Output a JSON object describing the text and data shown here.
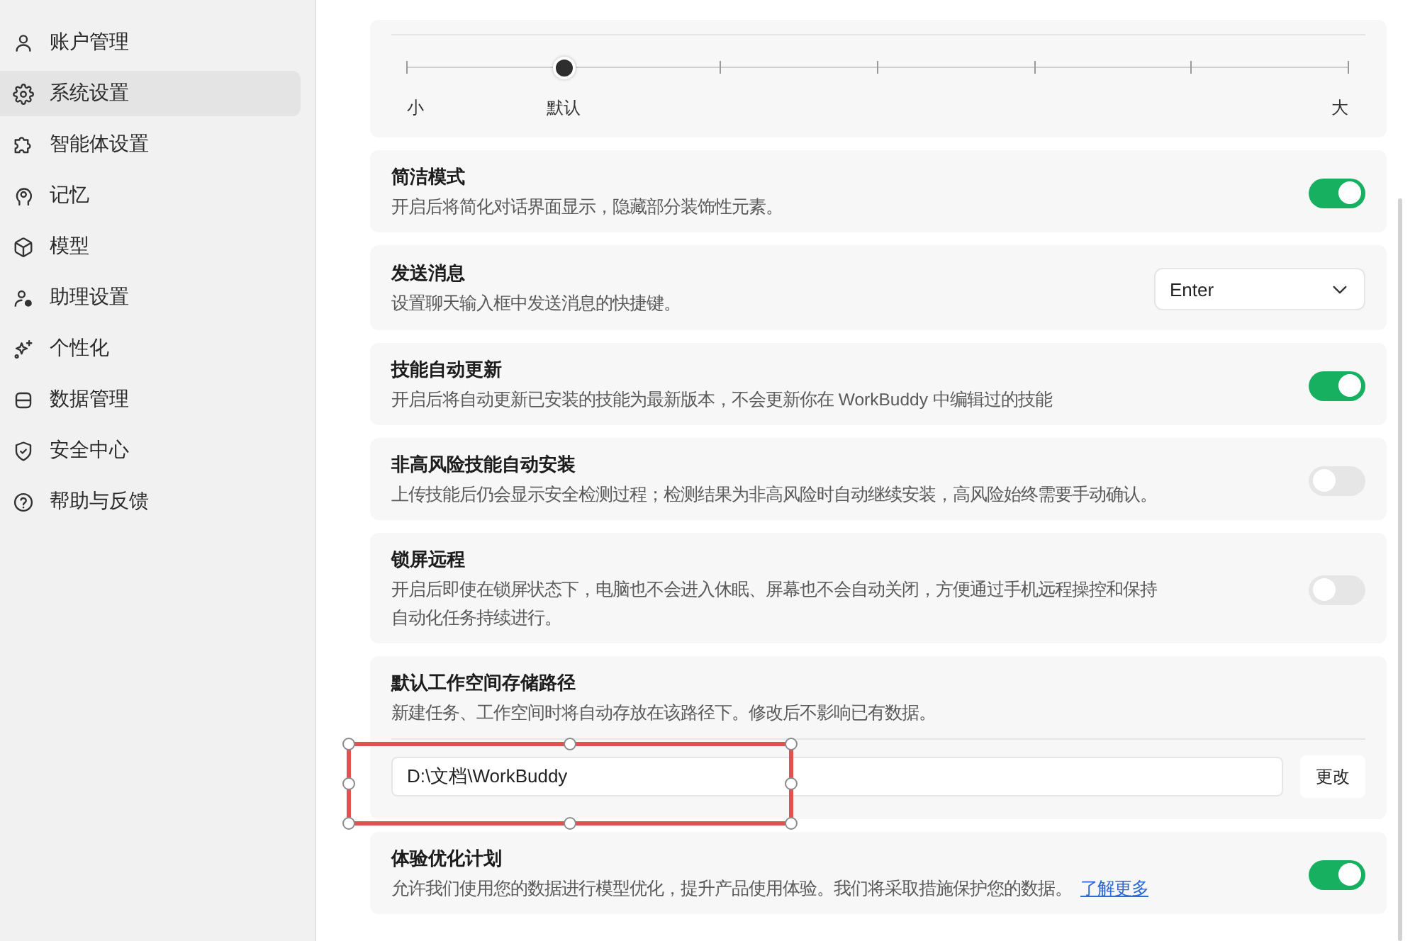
{
  "sidebar": {
    "items": [
      {
        "label": "账户管理",
        "selected": false
      },
      {
        "label": "系统设置",
        "selected": true
      },
      {
        "label": "智能体设置",
        "selected": false
      },
      {
        "label": "记忆",
        "selected": false
      },
      {
        "label": "模型",
        "selected": false
      },
      {
        "label": "助理设置",
        "selected": false
      },
      {
        "label": "个性化",
        "selected": false
      },
      {
        "label": "数据管理",
        "selected": false
      },
      {
        "label": "安全中心",
        "selected": false
      },
      {
        "label": "帮助与反馈",
        "selected": false
      }
    ]
  },
  "font_size": {
    "level": 0.1667,
    "min_label": "小",
    "default_label": "默认",
    "max_label": "大"
  },
  "settings": [
    {
      "kind": "toggle",
      "title": "简洁模式",
      "description": "开启后将简化对话界面显示，隐藏部分装饰性元素。",
      "on": true
    },
    {
      "kind": "select",
      "title": "发送消息",
      "description": "设置聊天输入框中发送消息的快捷键。",
      "value": "Enter"
    },
    {
      "kind": "toggle",
      "title": "技能自动更新",
      "description": "开启后将自动更新已安装的技能为最新版本，不会更新你在 WorkBuddy 中编辑过的技能",
      "on": true
    },
    {
      "kind": "toggle",
      "title": "非高风险技能自动安装",
      "description": "上传技能后仍会显示安全检测过程；检测结果为非高风险时自动继续安装，高风险始终需要手动确认。",
      "on": false
    },
    {
      "kind": "toggle",
      "title": "锁屏远程",
      "description": "开启后即使在锁屏状态下，电脑也不会进入休眠、屏幕也不会自动关闭，方便通过手机远程操控和保持自动化任务持续进行。",
      "on": false
    },
    {
      "kind": "path",
      "title": "默认工作空间存储路径",
      "description": "新建任务、工作空间时将自动存放在该路径下。修改后不影响已有数据。",
      "value": "D:\\文档\\WorkBuddy",
      "button": "更改",
      "highlighted": true
    },
    {
      "kind": "toggle",
      "title": "体验优化计划",
      "description": "允许我们使用您的数据进行模型优化，提升产品使用体验。我们将采取措施保护您的数据。",
      "link": "了解更多",
      "on": true
    }
  ]
}
